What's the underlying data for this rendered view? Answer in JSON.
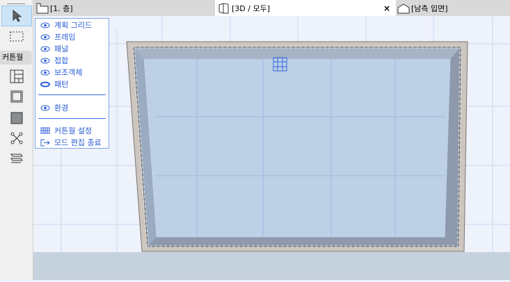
{
  "toolbox": {
    "section_label": "커튼월"
  },
  "tabs": [
    {
      "label": "[1. 층]"
    },
    {
      "label": "[3D / 모두]",
      "close": "×"
    },
    {
      "label": "[남측 입면]"
    }
  ],
  "menu": {
    "items": [
      "계획 그리드",
      "프레임",
      "패널",
      "접합",
      "보조객체",
      "패턴"
    ],
    "environment": "환경",
    "settings": "커튼월 설정",
    "exit": "모드 편집 종료"
  },
  "colors": {
    "accent": "#2a5cd6",
    "glass": "#b9cbe2",
    "frame": "#cbc3bd"
  }
}
